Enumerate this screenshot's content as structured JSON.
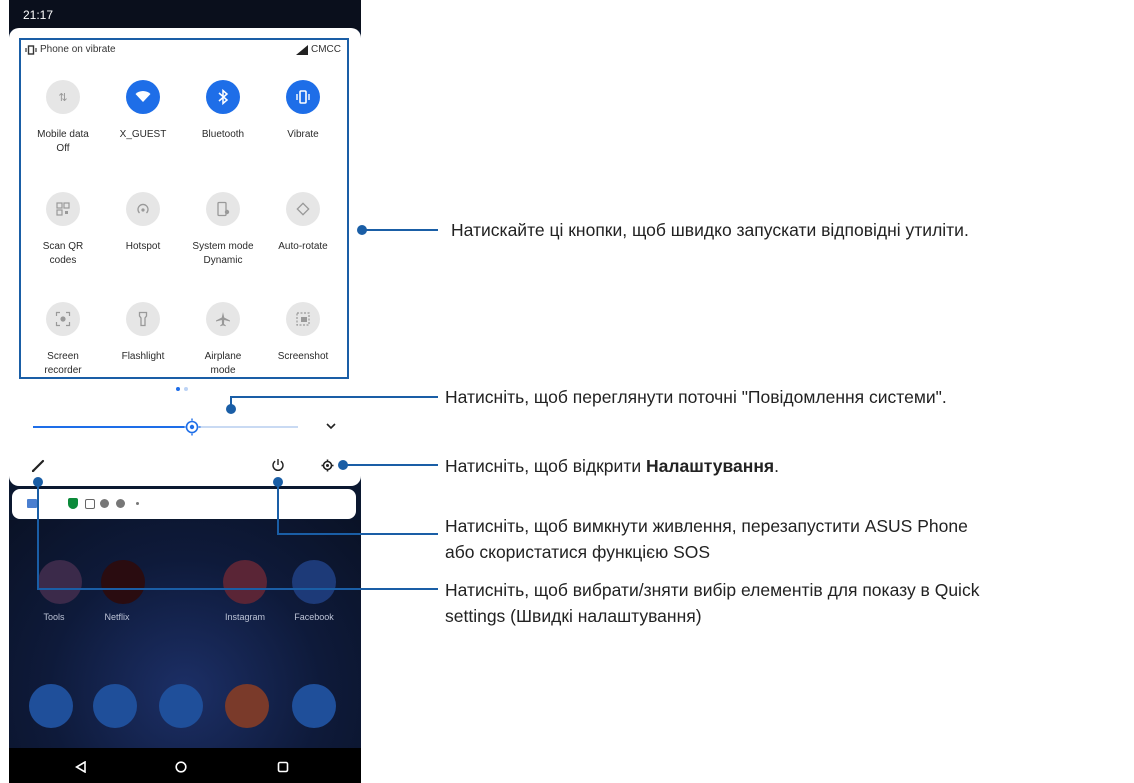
{
  "status_bar": {
    "time": "21:17"
  },
  "shade": {
    "vibrate_status": "Phone on vibrate",
    "carrier": "CMCC",
    "tiles": [
      {
        "label": "Mobile data",
        "sub": "Off",
        "state": "off",
        "icon": "mobile-data-icon"
      },
      {
        "label": "X_GUEST",
        "sub": "",
        "state": "on",
        "icon": "wifi-icon"
      },
      {
        "label": "Bluetooth",
        "sub": "",
        "state": "on",
        "icon": "bluetooth-icon"
      },
      {
        "label": "Vibrate",
        "sub": "",
        "state": "on",
        "icon": "vibrate-icon"
      },
      {
        "label": "Scan QR",
        "sub": "codes",
        "state": "off",
        "icon": "qr-icon"
      },
      {
        "label": "Hotspot",
        "sub": "",
        "state": "off",
        "icon": "hotspot-icon"
      },
      {
        "label": "System mode",
        "sub": "Dynamic",
        "state": "off",
        "icon": "system-mode-icon"
      },
      {
        "label": "Auto-rotate",
        "sub": "",
        "state": "off",
        "icon": "auto-rotate-icon"
      },
      {
        "label": "Screen",
        "sub": "recorder",
        "state": "off",
        "icon": "screen-recorder-icon"
      },
      {
        "label": "Flashlight",
        "sub": "",
        "state": "off",
        "icon": "flashlight-icon"
      },
      {
        "label": "Airplane",
        "sub": "mode",
        "state": "off",
        "icon": "airplane-icon"
      },
      {
        "label": "Screenshot",
        "sub": "",
        "state": "off",
        "icon": "screenshot-icon"
      }
    ],
    "page_count": 2,
    "brightness_level": 0.6
  },
  "home": {
    "apps": [
      "Tools",
      "Netflix",
      "Instagram",
      "Facebook"
    ]
  },
  "colors": {
    "accent": "#1e6ee8",
    "callout": "#1a5ea6"
  },
  "callouts": {
    "quick_tiles": "Натискайте ці кнопки, щоб швидко запускати відповідні утиліти.",
    "notifications": "Натисніть, щоб переглянути поточні \"Повідомлення системи\".",
    "settings_prefix": "Натисніть, щоб відкрити ",
    "settings_bold": "Налаштування",
    "settings_suffix": ".",
    "power_line1": "Натисніть, щоб вимкнути живлення, перезапустити ASUS Phone",
    "power_line2": "або скористатися функцією SOS",
    "edit_line1": "Натисніть, щоб вибрати/зняти вибір елементів для показу в Quick",
    "edit_line2": "settings (Швидкі налаштування)"
  }
}
